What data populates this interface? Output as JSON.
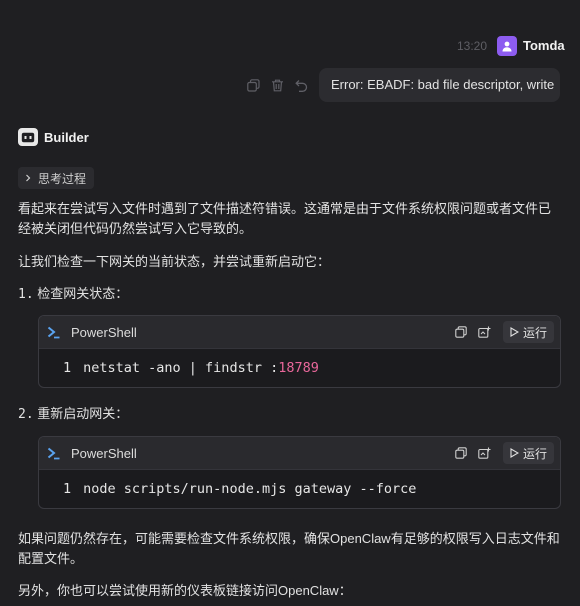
{
  "user": {
    "time": "13:20",
    "name": "Tomda",
    "message": "Error: EBADF: bad file descriptor, write"
  },
  "assistant": {
    "name": "Builder",
    "thinking_label": "思考过程",
    "intro": "看起来在尝试写入文件时遇到了文件描述符错误。这通常是由于文件系统权限问题或者文件已经被关闭但代码仍然尝试写入它导致的。",
    "plan": "让我们检查一下网关的当前状态，并尝试重新启动它：",
    "steps": [
      {
        "num": "1.",
        "label": "检查网关状态：",
        "code": {
          "lang": "PowerShell",
          "run_label": "运行",
          "line_no": "1",
          "text": "netstat -ano | findstr :",
          "number": "18789"
        }
      },
      {
        "num": "2.",
        "label": "重新启动网关：",
        "code": {
          "lang": "PowerShell",
          "run_label": "运行",
          "line_no": "1",
          "text": "node scripts/run-node.mjs gateway --force",
          "number": ""
        }
      }
    ],
    "after": "如果问题仍然存在，可能需要检查文件系统权限，确保OpenClaw有足够的权限写入日志文件和配置文件。",
    "final": "另外，你也可以尝试使用新的仪表板链接访问OpenClaw："
  }
}
